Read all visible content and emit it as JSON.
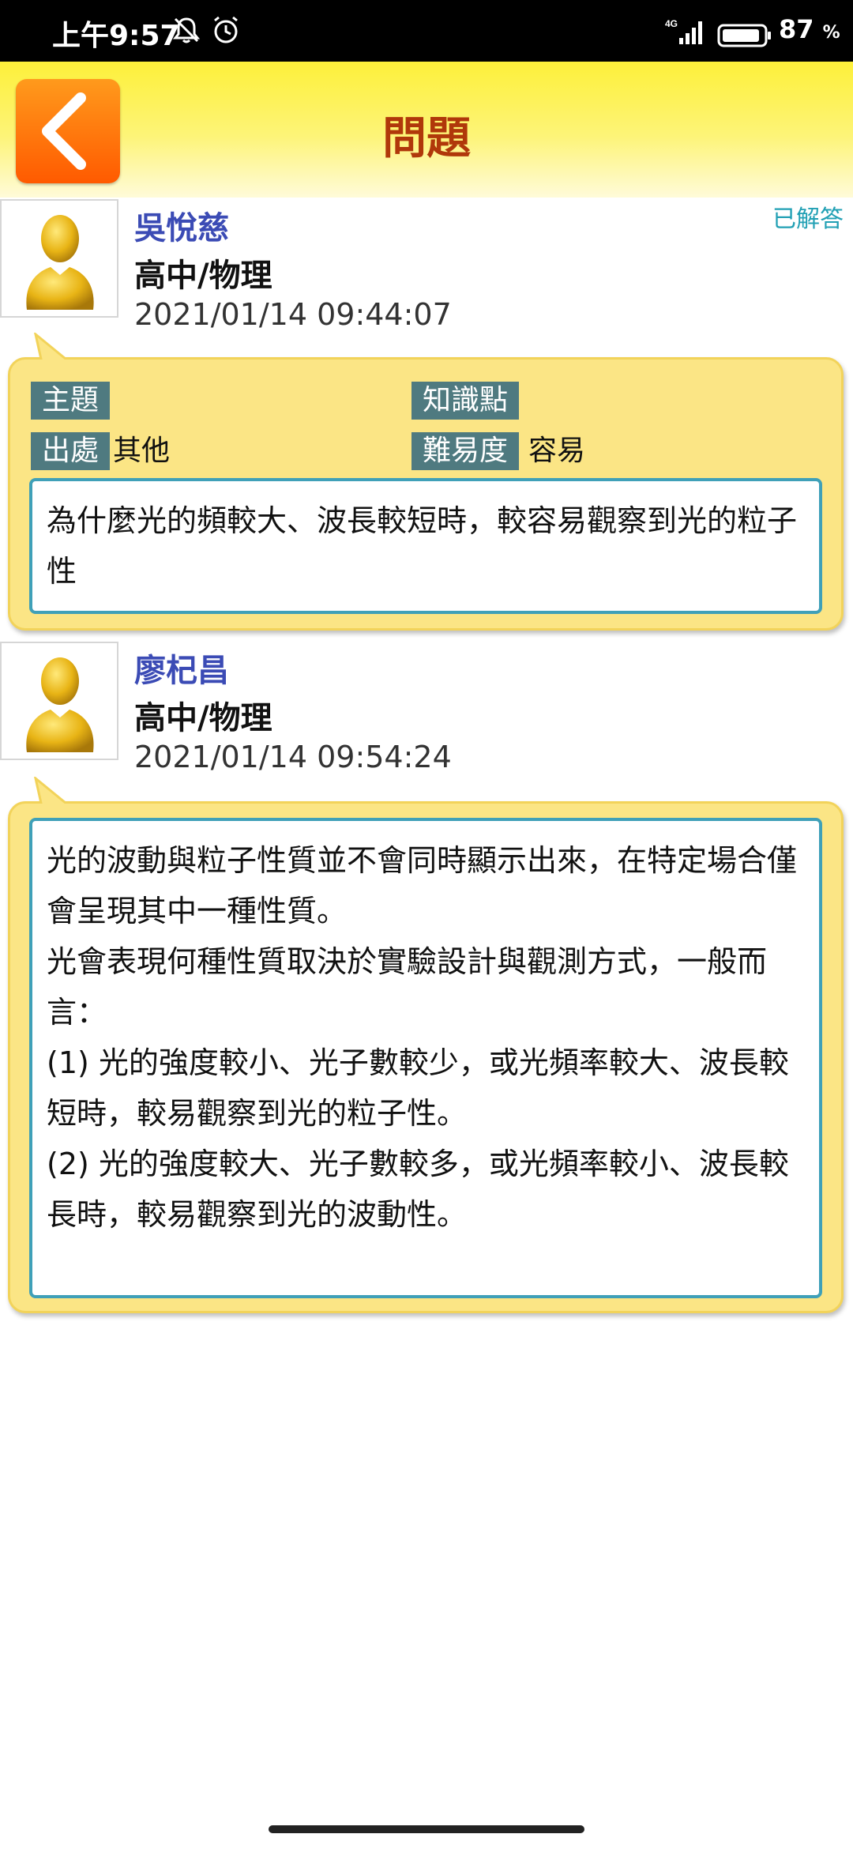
{
  "status_bar": {
    "time": "上午9:57",
    "network": "4G",
    "battery_level": "87",
    "battery_unit": "%",
    "icons": [
      "mute-icon",
      "alarm-icon",
      "signal-icon",
      "battery-icon"
    ]
  },
  "header": {
    "title": "問題",
    "back_icon": "chevron-left-icon",
    "accent_color": "#b0380a",
    "back_button_color": "#ff6a00"
  },
  "question": {
    "author": "吳悅慈",
    "subject": "高中/物理",
    "datetime": "2021/01/14 09:44:07",
    "status": "已解答",
    "tags": {
      "topic_label": "主題",
      "topic_value": "",
      "knowledge_label": "知識點",
      "knowledge_value": "",
      "source_label": "出處",
      "source_value": "其他",
      "difficulty_label": "難易度",
      "difficulty_value": "容易"
    },
    "body": "為什麼光的頻較大、波長較短時，較容易觀察到光的粒子性"
  },
  "answer": {
    "author": "廖杞昌",
    "subject": "高中/物理",
    "datetime": "2021/01/14 09:54:24",
    "body": "光的波動與粒子性質並不會同時顯示出來，在特定場合僅會呈現其中一種性質。\n光會表現何種性質取決於實驗設計與觀測方式，一般而言：\n(1) 光的強度較小、光子數較少，或光頻率較大、波長較短時，較易觀察到光的粒子性。\n(2) 光的強度較大、光子數較多，或光頻率較小、波長較長時，較易觀察到光的波動性。"
  }
}
